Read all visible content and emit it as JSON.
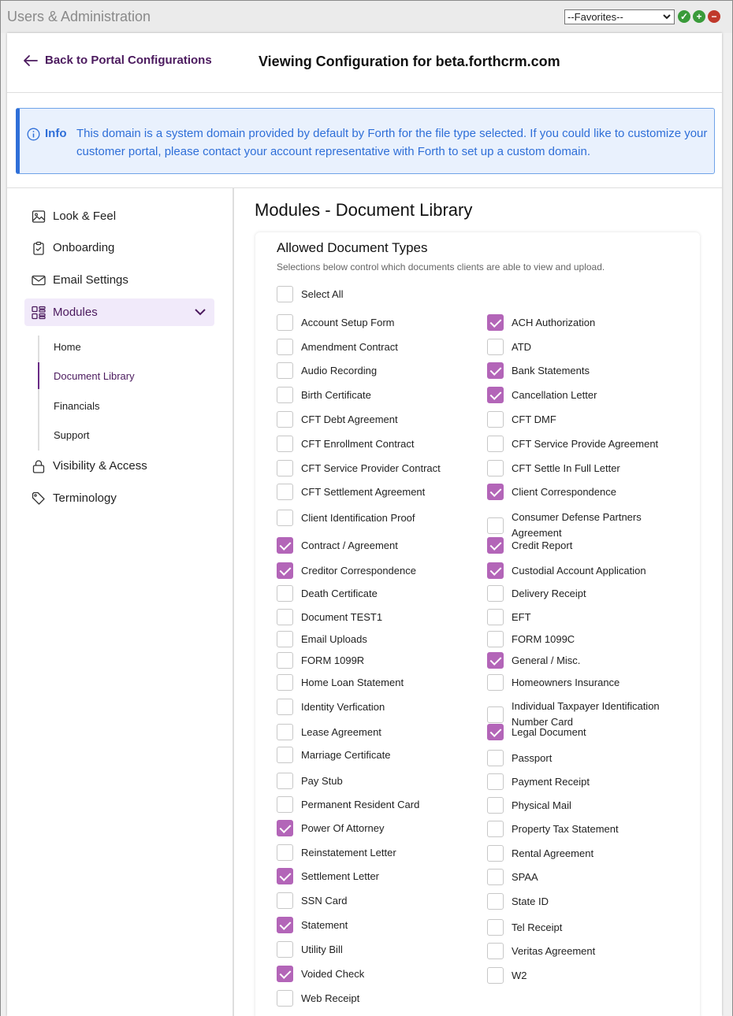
{
  "window": {
    "title": "Users & Administration",
    "favorites_value": "--Favorites--"
  },
  "header": {
    "back_label": "Back to Portal Configurations",
    "title": "Viewing Configuration for beta.forthcrm.com"
  },
  "info": {
    "label": "Info",
    "text": "This domain is a system domain provided by default by Forth for the file type selected. If you could like to customize your customer portal, please contact your account representative with Forth to set up a custom domain."
  },
  "sidebar": {
    "items": [
      {
        "label": "Look & Feel",
        "icon": "image-icon"
      },
      {
        "label": "Onboarding",
        "icon": "clipboard-icon"
      },
      {
        "label": "Email Settings",
        "icon": "envelope-icon"
      },
      {
        "label": "Modules",
        "icon": "modules-icon"
      },
      {
        "label": "Visibility & Access",
        "icon": "lock-icon"
      },
      {
        "label": "Terminology",
        "icon": "tag-icon"
      }
    ],
    "subitems": [
      "Home",
      "Document Library",
      "Financials",
      "Support"
    ]
  },
  "main": {
    "section_title": "Modules - Document Library",
    "card_title": "Allowed Document Types",
    "card_subtitle": "Selections below control which documents clients are able to view and upload.",
    "select_all": "Select All",
    "left_items": [
      {
        "label": "Account Setup Form",
        "checked": false
      },
      {
        "label": "Amendment Contract",
        "checked": false
      },
      {
        "label": "Audio Recording",
        "checked": false
      },
      {
        "label": "Birth Certificate",
        "checked": false
      },
      {
        "label": "CFT Debt Agreement",
        "checked": false
      },
      {
        "label": "CFT Enrollment Contract",
        "checked": false
      },
      {
        "label": "CFT Service Provider Contract",
        "checked": false
      },
      {
        "label": "CFT Settlement Agreement",
        "checked": false
      },
      {
        "label": "Client Identification Proof",
        "checked": false
      },
      {
        "label": "Contract / Agreement",
        "checked": true
      },
      {
        "label": "Creditor Correspondence",
        "checked": true
      },
      {
        "label": "Death Certificate",
        "checked": false
      },
      {
        "label": "Document TEST1",
        "checked": false
      },
      {
        "label": "Email Uploads",
        "checked": false
      },
      {
        "label": "FORM 1099R",
        "checked": false
      },
      {
        "label": "Home Loan Statement",
        "checked": false
      },
      {
        "label": "Identity Verfication",
        "checked": false
      },
      {
        "label": "Lease Agreement",
        "checked": false
      },
      {
        "label": "Marriage Certificate",
        "checked": false
      },
      {
        "label": "Pay Stub",
        "checked": false
      },
      {
        "label": "Permanent Resident Card",
        "checked": false
      },
      {
        "label": "Power Of Attorney",
        "checked": true
      },
      {
        "label": "Reinstatement Letter",
        "checked": false
      },
      {
        "label": "Settlement Letter",
        "checked": true
      },
      {
        "label": "SSN Card",
        "checked": false
      },
      {
        "label": "Statement",
        "checked": true
      },
      {
        "label": "Utility Bill",
        "checked": false
      },
      {
        "label": "Voided Check",
        "checked": true
      },
      {
        "label": "Web Receipt",
        "checked": false
      }
    ],
    "right_items": [
      {
        "label": "ACH Authorization",
        "checked": true
      },
      {
        "label": "ATD",
        "checked": false
      },
      {
        "label": "Bank Statements",
        "checked": true
      },
      {
        "label": "Cancellation Letter",
        "checked": true
      },
      {
        "label": "CFT DMF",
        "checked": false
      },
      {
        "label": "CFT Service Provide Agreement",
        "checked": false
      },
      {
        "label": "CFT Settle In Full Letter",
        "checked": false
      },
      {
        "label": "Client Correspondence",
        "checked": true
      },
      {
        "label": "Consumer Defense Partners Agreement",
        "checked": false
      },
      {
        "label": "Credit Report",
        "checked": true
      },
      {
        "label": "Custodial Account Application",
        "checked": true
      },
      {
        "label": "Delivery Receipt",
        "checked": false
      },
      {
        "label": "EFT",
        "checked": false
      },
      {
        "label": "FORM 1099C",
        "checked": false
      },
      {
        "label": "General / Misc.",
        "checked": true
      },
      {
        "label": "Homeowners Insurance",
        "checked": false
      },
      {
        "label": "Individual Taxpayer Identification Number Card",
        "checked": false
      },
      {
        "label": "Legal Document",
        "checked": true
      },
      {
        "label": "Passport",
        "checked": false
      },
      {
        "label": "Payment Receipt",
        "checked": false
      },
      {
        "label": "Physical Mail",
        "checked": false
      },
      {
        "label": "Property Tax Statement",
        "checked": false
      },
      {
        "label": "Rental Agreement",
        "checked": false
      },
      {
        "label": "SPAA",
        "checked": false
      },
      {
        "label": "State ID",
        "checked": false
      },
      {
        "label": "Tel Receipt",
        "checked": false
      },
      {
        "label": "Veritas Agreement",
        "checked": false
      },
      {
        "label": "W2",
        "checked": false
      }
    ]
  },
  "colors": {
    "accent": "#4b1a5e",
    "checkbox_checked": "#b365b8",
    "info_blue": "#2f6fd8",
    "info_bg": "#e9f1fd"
  }
}
